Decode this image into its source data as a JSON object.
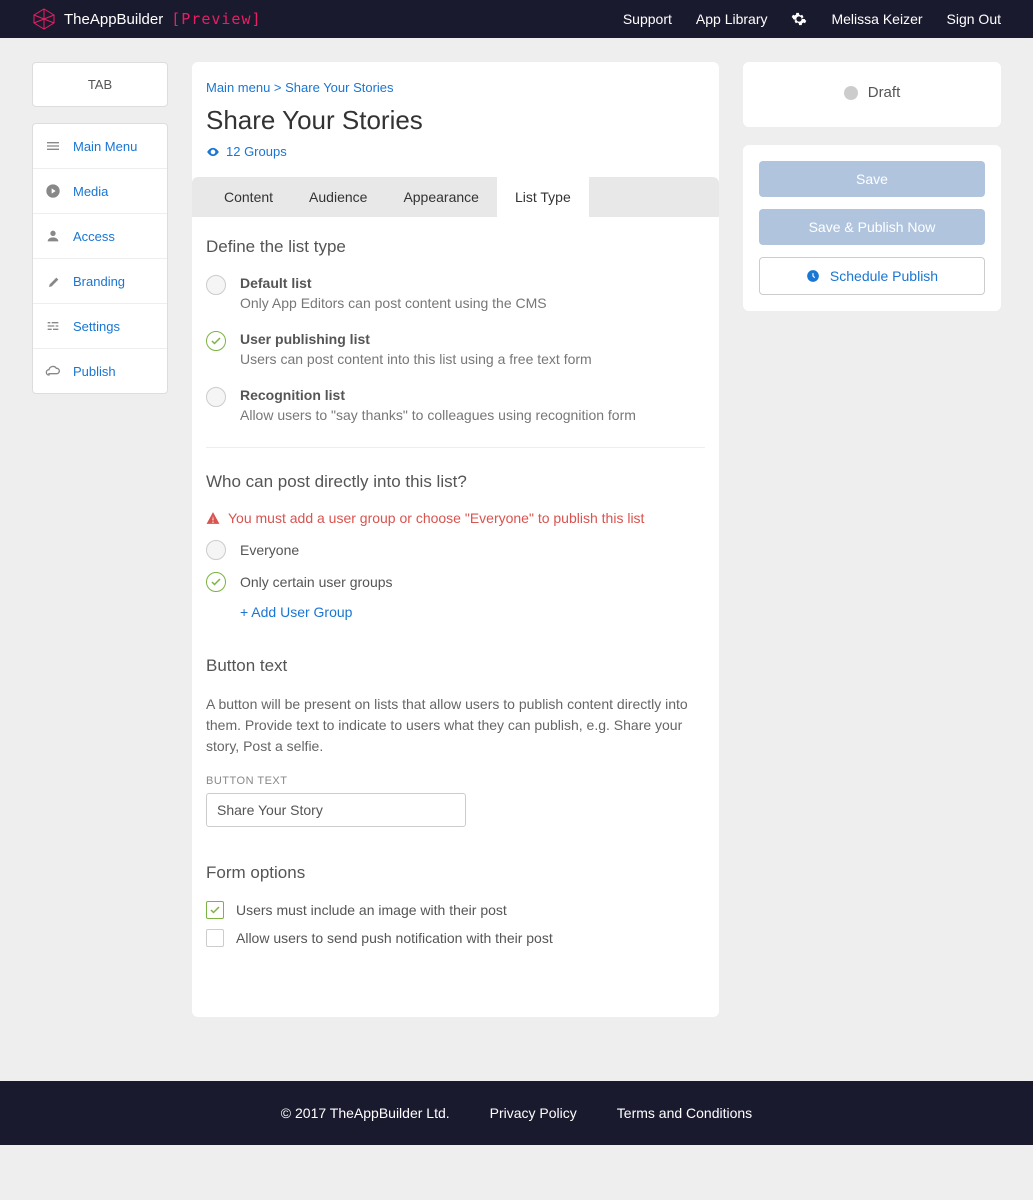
{
  "header": {
    "brand": "TheAppBuilder",
    "preview": "[Preview]",
    "nav": {
      "support": "Support",
      "library": "App Library",
      "user": "Melissa Keizer",
      "signout": "Sign Out"
    }
  },
  "sidebar": {
    "tab": "TAB",
    "items": [
      "Main Menu",
      "Media",
      "Access",
      "Branding",
      "Settings",
      "Publish"
    ]
  },
  "breadcrumb": "Main menu > Share Your Stories",
  "page_title": "Share Your Stories",
  "groups": "12 Groups",
  "tabs": [
    "Content",
    "Audience",
    "Appearance",
    "List Type"
  ],
  "active_tab": 3,
  "list_type": {
    "heading": "Define the list type",
    "options": [
      {
        "label": "Default list",
        "desc": "Only App Editors can post content using the CMS",
        "selected": false
      },
      {
        "label": "User publishing list",
        "desc": "Users can post content into this list using a free text form",
        "selected": true
      },
      {
        "label": "Recognition list",
        "desc": "Allow users to \"say thanks\" to colleagues using recognition form",
        "selected": false
      }
    ]
  },
  "who_post": {
    "heading": "Who can post directly into this list?",
    "warning": "You must add a user group or choose \"Everyone\" to publish this list",
    "everyone": "Everyone",
    "only_groups": "Only certain user groups",
    "add_group": "+ Add User Group",
    "selected": "only_groups"
  },
  "button_text": {
    "heading": "Button text",
    "desc": "A button will be present on lists that allow users to publish content directly into them. Provide text to indicate to users what they can publish, e.g. Share your story, Post a selfie.",
    "label": "BUTTON TEXT",
    "value": "Share Your Story"
  },
  "form_options": {
    "heading": "Form options",
    "items": [
      {
        "label": "Users must include an image with their post",
        "checked": true
      },
      {
        "label": "Allow users to send push notification with their post",
        "checked": false
      }
    ]
  },
  "status": {
    "label": "Draft"
  },
  "actions": {
    "save": "Save",
    "publish": "Save & Publish Now",
    "schedule": "Schedule Publish"
  },
  "footer": {
    "copyright": "© 2017 TheAppBuilder Ltd.",
    "privacy": "Privacy Policy",
    "terms": "Terms and Conditions"
  }
}
